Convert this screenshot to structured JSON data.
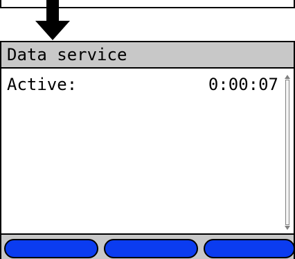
{
  "screen": {
    "title": "Data service",
    "status": {
      "label": "Active:",
      "value": "0:00:07"
    }
  },
  "softkeys": [
    {
      "label": "",
      "color": "#0b3cf0"
    },
    {
      "label": "",
      "color": "#0b3cf0"
    },
    {
      "label": "",
      "color": "#0b3cf0"
    }
  ],
  "icons": {
    "arrow": "down-arrow-icon",
    "scroll_up": "scroll-up-icon",
    "scroll_down": "scroll-down-icon"
  },
  "colors": {
    "titlebar": "#c8c8c8",
    "softkey": "#0b3cf0",
    "border": "#000000"
  }
}
